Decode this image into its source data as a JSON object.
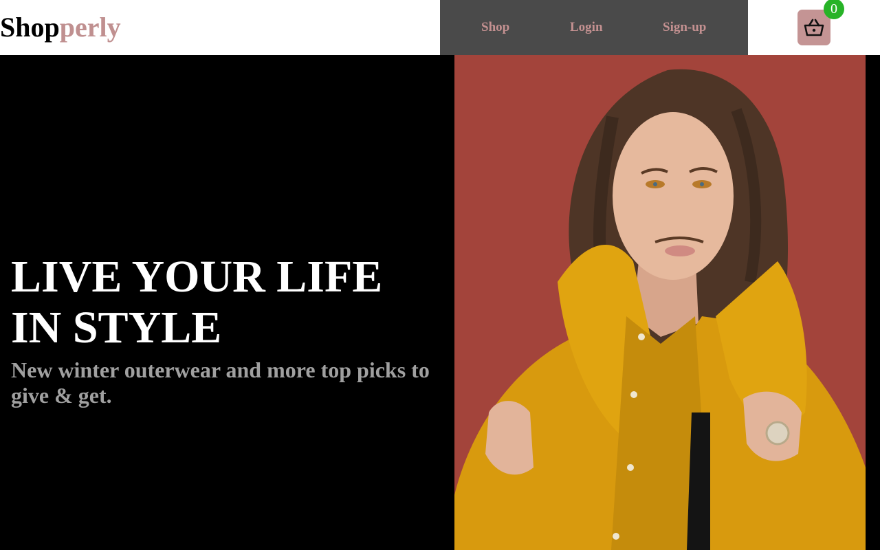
{
  "header": {
    "logo_part1": "Shop",
    "logo_part2": "perly"
  },
  "nav": {
    "items": [
      {
        "label": "Shop"
      },
      {
        "label": "Login"
      },
      {
        "label": "Sign-up"
      }
    ]
  },
  "cart": {
    "icon": "basket-icon",
    "count": "0"
  },
  "hero": {
    "title": "LIVE YOUR LIFE IN STYLE",
    "subtitle": "New winter outerwear and more top picks to give & get.",
    "image": "fashion-model-photo"
  },
  "colors": {
    "brand_accent": "#c49494",
    "nav_background": "#4a4a4a",
    "badge": "#27b327",
    "hero_background": "#000000",
    "photo_background": "#a3443b",
    "coat": "#d89a0e"
  }
}
